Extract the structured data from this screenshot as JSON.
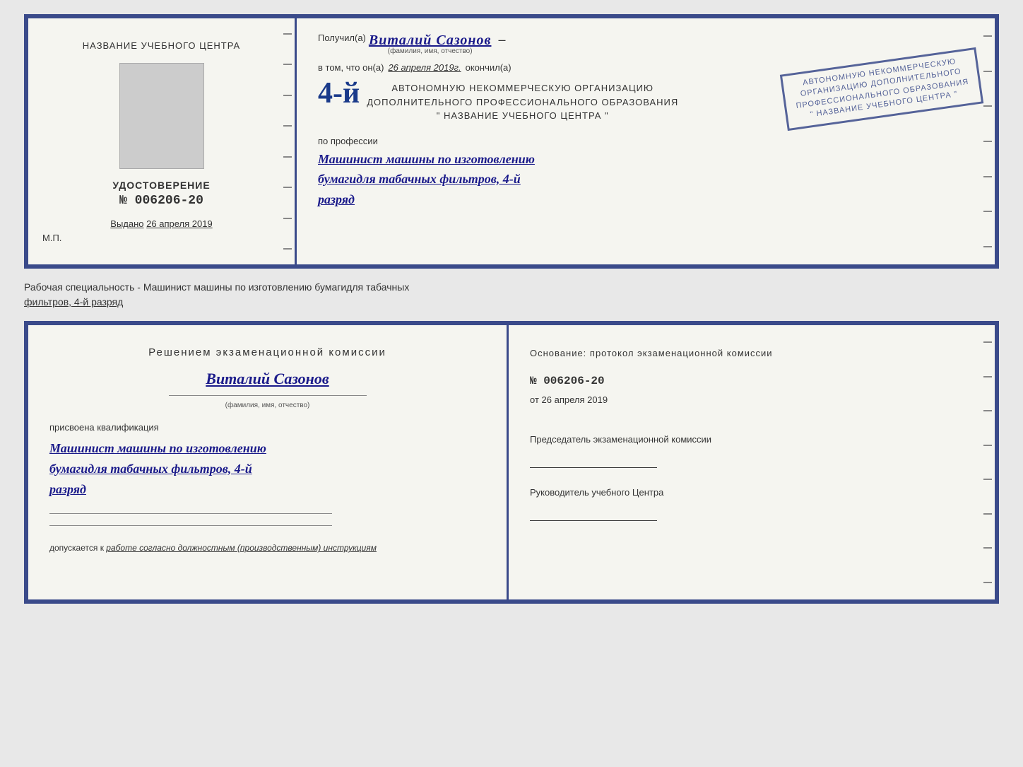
{
  "top_cert": {
    "left": {
      "title": "НАЗВАНИЕ УЧЕБНОГО ЦЕНТРА",
      "doc_type": "УДОСТОВЕРЕНИЕ",
      "doc_number": "№ 006206-20",
      "issued_label": "Выдано",
      "issued_date": "26 апреля 2019",
      "mp_label": "М.П."
    },
    "right": {
      "received_label": "Получил(а)",
      "recipient_name": "Виталий Сазонов",
      "fio_hint": "(фамилия, имя, отчество)",
      "vtom_label": "в том, что он(а)",
      "date_label": "26 апреля 2019г.",
      "finished_label": "окончил(а)",
      "org_line1": "АВТОНОМНУЮ НЕКОММЕРЧЕСКУЮ ОРГАНИЗАЦИЮ",
      "org_line2": "ДОПОЛНИТЕЛЬНОГО ПРОФЕССИОНАЛЬНОГО ОБРАЗОВАНИЯ",
      "org_line3": "\" НАЗВАНИЕ УЧЕБНОГО ЦЕНТРА \"",
      "profession_label": "по профессии",
      "profession_name": "Машинист машины по изготовлению",
      "profession_name2": "бумагидля табачных фильтров, 4-й",
      "profession_name3": "разряд",
      "stamp_line1": "АВТОНОМНУЮ НЕКОММЕРЧЕСКУЮ",
      "stamp_line2": "ОРГАНИЗАЦИЮ ДОПОЛНИТЕЛЬНОГО",
      "stamp_line3": "ПРОФЕССИОНАЛЬНОГО ОБРАЗОВАНИЯ",
      "stamp_line4": "\" НАЗВАНИЕ УЧЕБНОГО ЦЕНТРА \""
    }
  },
  "middle": {
    "text": "Рабочая специальность - Машинист машины по изготовлению бумагидля табачных",
    "text2": "фильтров, 4-й разряд"
  },
  "bottom_cert": {
    "left": {
      "decision_title": "Решением  экзаменационной  комиссии",
      "person_name": "Виталий Сазонов",
      "fio_hint": "(фамилия, имя, отчество)",
      "kvali_label": "присвоена квалификация",
      "profession1": "Машинист машины по изготовлению",
      "profession2": "бумагидля табачных фильтров, 4-й",
      "profession3": "разряд",
      "допускается_label": "допускается к",
      "допускается_value": "работе согласно должностным (производственным) инструкциям"
    },
    "right": {
      "osnov_label": "Основание: протокол экзаменационной  комиссии",
      "prot_number": "№  006206-20",
      "prot_date_prefix": "от",
      "prot_date": "26 апреля 2019",
      "chairman_label": "Председатель экзаменационной комиссии",
      "head_label": "Руководитель учебного Центра"
    }
  }
}
